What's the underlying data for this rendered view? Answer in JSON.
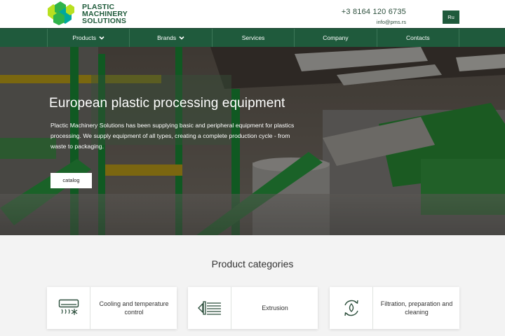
{
  "brand": {
    "line1": "PLASTIC",
    "line2": "MACHINERY",
    "line3": "SOLUTIONS",
    "colors": [
      "#1e5a3a",
      "#2fb34a",
      "#b8e020",
      "#00a89d"
    ]
  },
  "header": {
    "phone": "+3 8164 120 6735",
    "email": "info@pms.rs",
    "language": "Ru"
  },
  "nav": {
    "items": [
      {
        "label": "Products",
        "icon": "chevron-down-icon"
      },
      {
        "label": "Brands",
        "icon": "chevron-down-icon"
      },
      {
        "label": "Services"
      },
      {
        "label": "Company"
      },
      {
        "label": "Contacts"
      }
    ]
  },
  "hero": {
    "title": "European plastic processing equipment",
    "text": "Plactic Machinery Solutions has been supplying basic and peripheral equipment for plastics processing. We supply equipment of all types, creating a complete production cycle - from waste to packaging.",
    "button": "catalog"
  },
  "categories": {
    "title": "Product categories",
    "items": [
      {
        "label": "Cooling and temperature control",
        "icon": "air-conditioner-icon"
      },
      {
        "label": "Extrusion",
        "icon": "extruder-icon"
      },
      {
        "label": "Filtration, preparation and cleaning",
        "icon": "water-cycle-icon"
      }
    ]
  },
  "colors": {
    "accent": "#1f5a3c",
    "page_bg": "#f3f3f3"
  }
}
